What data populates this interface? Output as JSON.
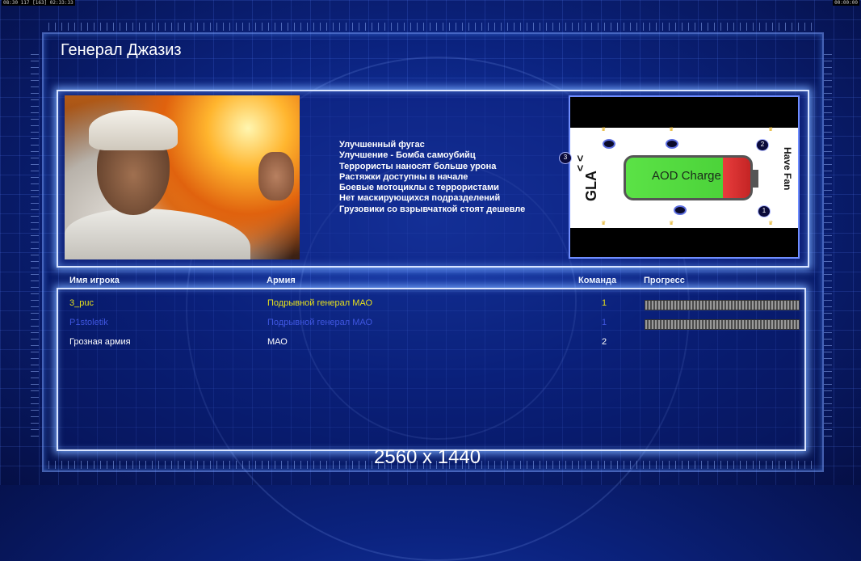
{
  "hud": {
    "left": "08:30 117 [163] 02:33:33",
    "right": "00:00:00"
  },
  "general": {
    "name": "Генерал Джазиз",
    "bonuses": [
      "Улучшенный фугас",
      "Улучшение - Бомба самоубийц",
      "Террористы наносят больше урона",
      "Растяжки доступны в начале",
      "Боевые мотоциклы с террористами",
      "Нет маскирующихся подразделений",
      "Грузовики со взрывчаткой стоят дешевле"
    ]
  },
  "map": {
    "battery_label": "AOD Charge",
    "left_label": "GLA",
    "right_label": "Have Fan",
    "chevrons": "< <",
    "slot_numbers": [
      "3",
      "2",
      "1"
    ]
  },
  "table": {
    "headers": {
      "name": "Имя игрока",
      "army": "Армия",
      "team": "Команда",
      "progress": "Прогресс"
    },
    "rows": [
      {
        "name": "3_puc",
        "army": "Подрывной генерал МАО",
        "team": "1",
        "color": "#e6e01c",
        "progress": 1.0
      },
      {
        "name": "P1stoletik",
        "army": "Подрывной генерал МАО",
        "team": "1",
        "color": "#3f56e0",
        "progress": 1.0
      },
      {
        "name": "Грозная армия",
        "army": "МАО",
        "team": "2",
        "color": "#ffffff",
        "progress": null
      }
    ]
  },
  "watermark": "2560 x 1440"
}
